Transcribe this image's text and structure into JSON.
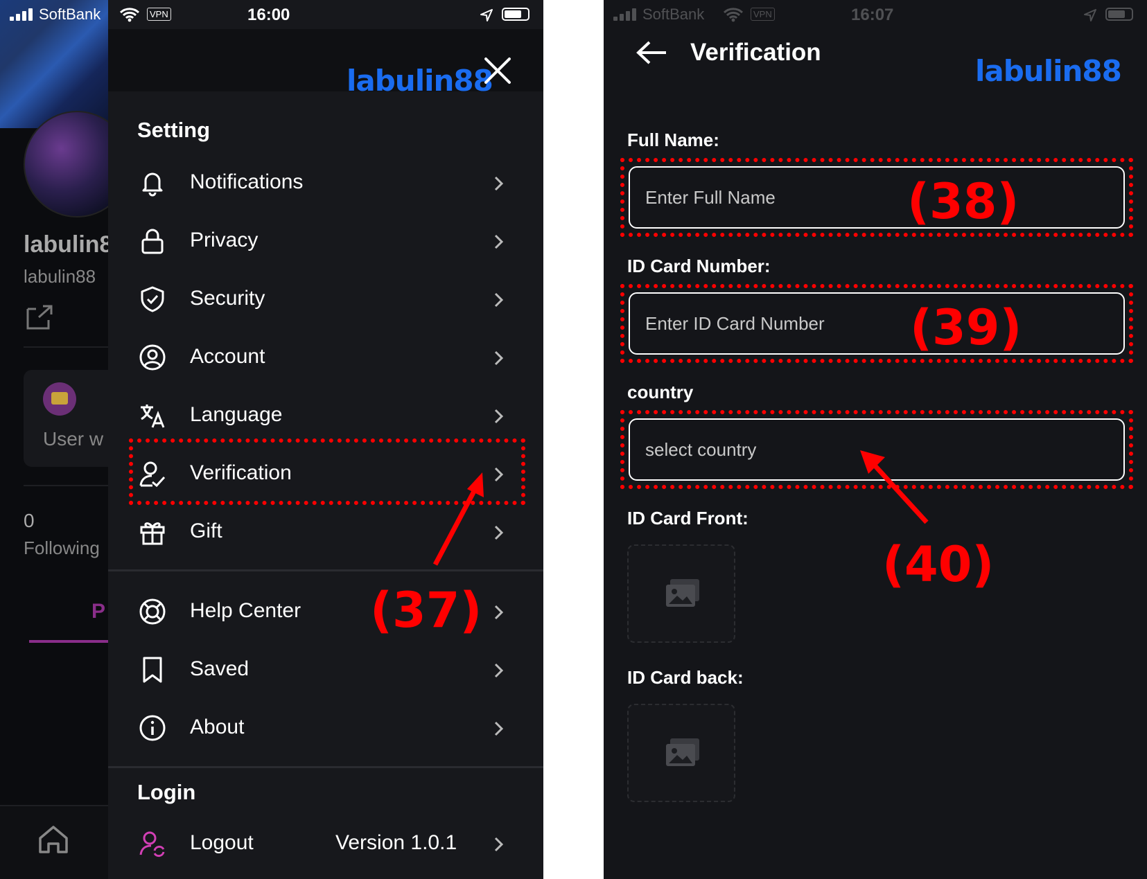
{
  "left_screen": {
    "status": {
      "carrier": "SoftBank",
      "vpn": "VPN",
      "time": "16:00"
    },
    "background": {
      "name": "labulin8",
      "handle": "labulin88",
      "user_wallet": "User w",
      "following_count": "0",
      "following_label": "Following",
      "tab": "P"
    },
    "watermark": "labulin88",
    "setting_title": "Setting",
    "items": [
      {
        "label": "Notifications",
        "icon": "bell-icon"
      },
      {
        "label": "Privacy",
        "icon": "lock-icon"
      },
      {
        "label": "Security",
        "icon": "shield-icon"
      },
      {
        "label": "Account",
        "icon": "user-circle-icon"
      },
      {
        "label": "Language",
        "icon": "translate-icon"
      },
      {
        "label": "Verification",
        "icon": "user-check-icon"
      },
      {
        "label": "Gift",
        "icon": "gift-icon"
      },
      {
        "label": "Help Center",
        "icon": "lifebuoy-icon"
      },
      {
        "label": "Saved",
        "icon": "bookmark-icon"
      },
      {
        "label": "About",
        "icon": "info-icon"
      }
    ],
    "login_title": "Login",
    "logout_label": "Logout",
    "version": "Version 1.0.1",
    "annotation": "(37)"
  },
  "right_screen": {
    "status": {
      "carrier": "SoftBank",
      "vpn": "VPN",
      "time": "16:07"
    },
    "title": "Verification",
    "watermark": "labulin88",
    "full_name_label": "Full Name:",
    "full_name_placeholder": "Enter Full Name",
    "id_number_label": "ID Card Number:",
    "id_number_placeholder": "Enter ID Card Number",
    "country_label": "country",
    "country_placeholder": "select country",
    "id_front_label": "ID Card Front:",
    "id_back_label": "ID Card back:",
    "annotations": [
      "(38)",
      "(39)",
      "(40)"
    ]
  },
  "colors": {
    "annotation": "#ff0000",
    "watermark": "#1a6cf0",
    "accent": "#8a2e8a"
  }
}
